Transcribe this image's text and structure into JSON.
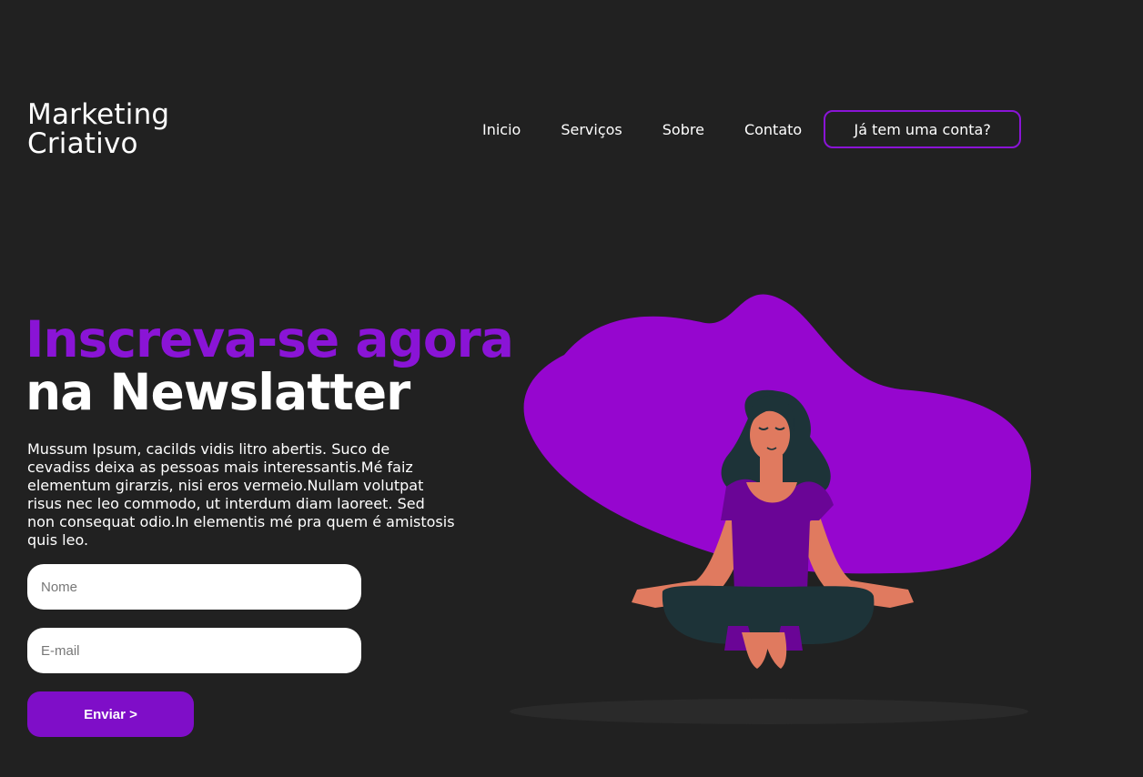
{
  "brand": {
    "line1": "Marketing",
    "line2": "Criativo"
  },
  "nav": {
    "items": [
      "Inicio",
      "Serviços",
      "Sobre",
      "Contato"
    ],
    "account_button": "Já tem uma conta?"
  },
  "hero": {
    "headline_accent": "Inscreva-se agora",
    "headline_main": "na Newslatter",
    "description": "Mussum Ipsum, cacilds vidis litro abertis. Suco de cevadiss deixa as pessoas mais interessantis.Mé faiz elementum girarzis, nisi eros vermeio.Nullam volutpat risus nec leo commodo, ut interdum diam laoreet. Sed non consequat odio.In elementis mé pra quem é amistosis quis leo."
  },
  "form": {
    "name_placeholder": "Nome",
    "name_value": "",
    "email_placeholder": "E-mail",
    "email_value": "",
    "submit_label": "Enviar >"
  },
  "colors": {
    "background": "#212121",
    "accent": "#8a14d6",
    "blob": "#9606cf",
    "button": "#7f0ec8"
  },
  "illustration": {
    "icon": "meditating-woman-illustration"
  }
}
